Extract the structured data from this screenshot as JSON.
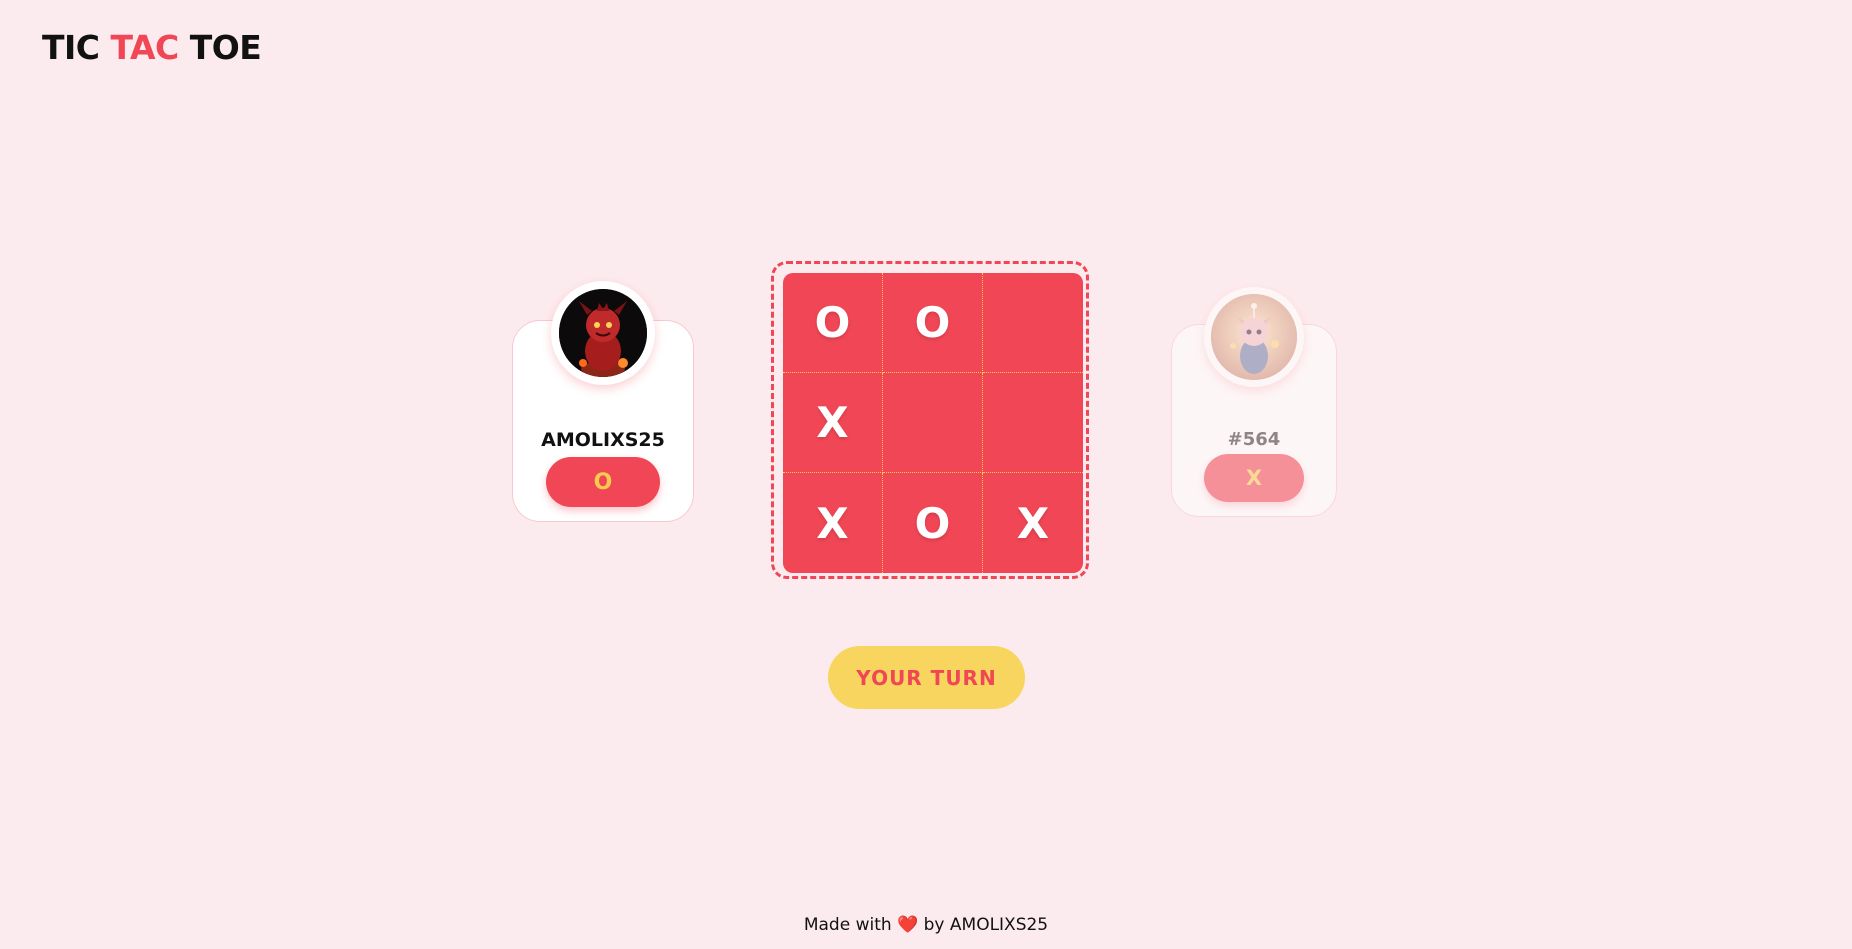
{
  "header": {
    "logo_part1": "TIC ",
    "logo_part2": "TAC",
    "logo_part3": " TOE",
    "accent_color": "#f04655"
  },
  "players": {
    "left": {
      "name": "AMOLIXS25",
      "symbol": "O",
      "avatar": "red-devil-avatar",
      "active": true
    },
    "right": {
      "name": "#564",
      "symbol": "X",
      "avatar": "glowing-creature-avatar",
      "active": false
    }
  },
  "board": {
    "cells": [
      "O",
      "O",
      "",
      "X",
      "",
      "",
      "X",
      "O",
      "X"
    ]
  },
  "status": {
    "label": "YOUR TURN"
  },
  "footer": {
    "prefix": "Made with",
    "heart": "❤️",
    "suffix": "by AMOLIXS25"
  },
  "colors": {
    "background": "#fcebee",
    "primary": "#f04655",
    "yellow": "#f8d55e"
  }
}
